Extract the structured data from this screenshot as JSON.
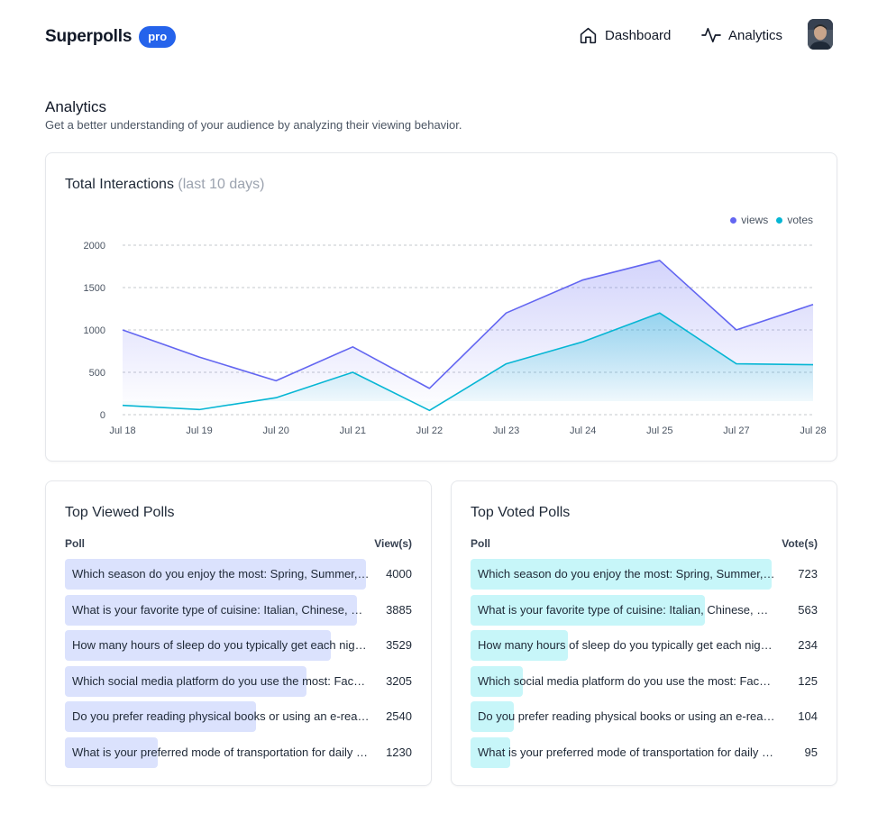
{
  "header": {
    "brand": "Superpolls",
    "badge": "pro",
    "nav": [
      {
        "label": "Dashboard",
        "icon": "home-icon"
      },
      {
        "label": "Analytics",
        "icon": "activity-icon"
      }
    ],
    "avatar_icon": "user-avatar"
  },
  "page": {
    "title": "Analytics",
    "subtitle": "Get a better understanding of your audience by analyzing their viewing behavior."
  },
  "chart_card": {
    "title": "Total Interactions",
    "title_suffix": "(last 10 days)"
  },
  "chart_data": {
    "type": "area",
    "title": "Total Interactions (last 10 days)",
    "xlabel": "",
    "ylabel": "",
    "categories": [
      "Jul 18",
      "Jul 19",
      "Jul 20",
      "Jul 21",
      "Jul 22",
      "Jul 23",
      "Jul 24",
      "Jul 25",
      "Jul 27",
      "Jul 28"
    ],
    "yticks": [
      0,
      500,
      1000,
      1500,
      2000
    ],
    "ylim": [
      0,
      2000
    ],
    "grid": true,
    "legend_position": "top-right",
    "series": [
      {
        "name": "views",
        "color": "#6366f1",
        "values": [
          1000,
          680,
          400,
          800,
          310,
          1200,
          1590,
          1820,
          1000,
          1300
        ]
      },
      {
        "name": "votes",
        "color": "#06b6d4",
        "values": [
          110,
          60,
          200,
          500,
          50,
          600,
          860,
          1200,
          600,
          590
        ]
      }
    ]
  },
  "top_viewed": {
    "title": "Top Viewed Polls",
    "col_poll": "Poll",
    "col_count": "View(s)",
    "bar_color": "#dbe2fd",
    "max": 4000,
    "rows": [
      {
        "label": "Which season do you enjoy the most: Spring, Summer, Autumn or Winter?",
        "value": 4000
      },
      {
        "label": "What is your favorite type of cuisine: Italian, Chinese, Mexican or Indian?",
        "value": 3885
      },
      {
        "label": "How many hours of sleep do you typically get each night?",
        "value": 3529
      },
      {
        "label": "Which social media platform do you use the most: Facebook, Instagram or Twitter?",
        "value": 3205
      },
      {
        "label": "Do you prefer reading physical books or using an e-reader?",
        "value": 2540
      },
      {
        "label": "What is your preferred mode of transportation for daily commuting?",
        "value": 1230
      }
    ]
  },
  "top_voted": {
    "title": "Top Voted Polls",
    "col_poll": "Poll",
    "col_count": "Vote(s)",
    "bar_color": "#c7f6f9",
    "max": 723,
    "rows": [
      {
        "label": "Which season do you enjoy the most: Spring, Summer, Fall or Winter?",
        "value": 723
      },
      {
        "label": "What is your favorite type of cuisine: Italian, Chinese, Mexican or Indian?",
        "value": 563
      },
      {
        "label": "How many hours of sleep do you typically get each night?",
        "value": 234
      },
      {
        "label": "Which social media platform do you use the most: Facebook, Instagram or Twitter?",
        "value": 125
      },
      {
        "label": "Do you prefer reading physical books or using an e-reader?",
        "value": 104
      },
      {
        "label": "What is your preferred mode of transportation for daily commuting?",
        "value": 95
      }
    ]
  }
}
